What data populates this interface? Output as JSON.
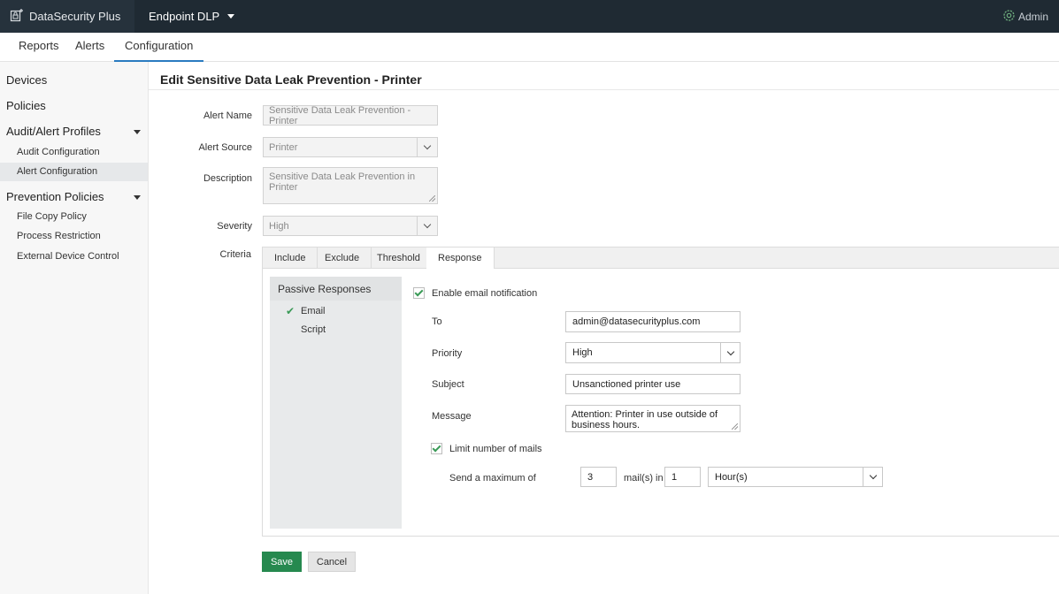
{
  "header": {
    "app_name": "DataSecurity Plus",
    "product": "Endpoint DLP",
    "user": "Admin"
  },
  "tabs": [
    {
      "label": "Reports",
      "active": false
    },
    {
      "label": "Alerts",
      "active": false
    },
    {
      "label": "Configuration",
      "active": true
    }
  ],
  "sidebar": {
    "devices": "Devices",
    "policies": "Policies",
    "audit_profiles": {
      "label": "Audit/Alert Profiles",
      "items": [
        {
          "label": "Audit Configuration",
          "active": false
        },
        {
          "label": "Alert Configuration",
          "active": true
        }
      ]
    },
    "prevention_policies": {
      "label": "Prevention Policies",
      "items": [
        {
          "label": "File Copy Policy"
        },
        {
          "label": "Process Restriction"
        },
        {
          "label": "External Device Control"
        }
      ]
    }
  },
  "page_title": "Edit Sensitive Data Leak Prevention - Printer",
  "form": {
    "alert_name_label": "Alert Name",
    "alert_name_value": "Sensitive Data Leak Prevention - Printer",
    "alert_source_label": "Alert Source",
    "alert_source_value": "Printer",
    "description_label": "Description",
    "description_value": "Sensitive Data Leak Prevention in Printer",
    "severity_label": "Severity",
    "severity_value": "High",
    "criteria_label": "Criteria"
  },
  "criteria": {
    "tabs": [
      "Include",
      "Exclude",
      "Threshold",
      "Response"
    ],
    "active_tab": "Response",
    "passive_responses": {
      "heading": "Passive Responses",
      "items": [
        {
          "label": "Email",
          "checked": true
        },
        {
          "label": "Script",
          "checked": false
        }
      ]
    },
    "email": {
      "enable_label": "Enable email notification",
      "enabled": true,
      "to_label": "To",
      "to_value": "admin@datasecurityplus.com",
      "priority_label": "Priority",
      "priority_value": "High",
      "subject_label": "Subject",
      "subject_value": "Unsanctioned printer use",
      "message_label": "Message",
      "message_value": "Attention: Printer in use outside of business hours.",
      "limit_label": "Limit number of mails",
      "limit_enabled": true,
      "max_label": "Send a maximum of",
      "max_value": "3",
      "per_label": "mail(s) in",
      "per_value": "1",
      "unit_value": "Hour(s)"
    }
  },
  "buttons": {
    "save": "Save",
    "cancel": "Cancel"
  },
  "colors": {
    "topbar": "#1f2a33",
    "accent": "#2a7bc0",
    "save_button": "#26894f",
    "check": "#3a9a57"
  },
  "icons": {
    "brand": "datasecurity-logo-icon",
    "admin": "admin-gear-icon",
    "check": "checkmark-icon"
  }
}
